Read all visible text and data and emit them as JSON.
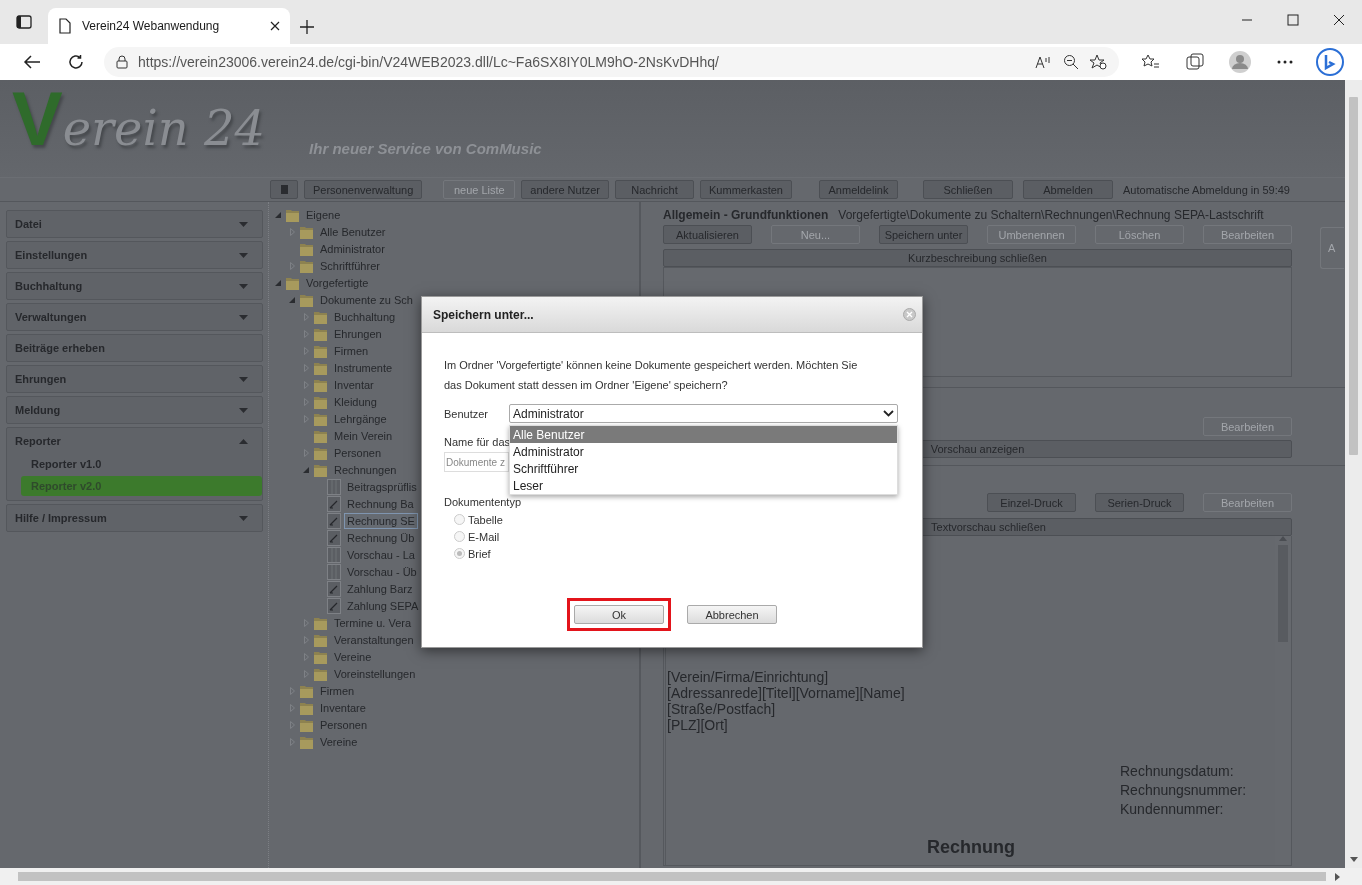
{
  "browser": {
    "tab_title": "Verein24 Webanwendung",
    "url": "https://verein23006.verein24.de/cgi-bin/V24WEB2023.dll/Lc~Fa6SX8IY0LM9hO-2NsKvDHhq/"
  },
  "header": {
    "logo": "Verein 24",
    "tagline": "Ihr neuer Service von ComMusic"
  },
  "toolbar": {
    "buttons": [
      {
        "label": "Personenverwaltung",
        "disabled": false
      },
      {
        "label": "neue Liste",
        "disabled": true
      },
      {
        "label": "andere Nutzer",
        "disabled": false
      },
      {
        "label": "Nachricht",
        "disabled": false
      },
      {
        "label": "Kummerkasten",
        "disabled": false
      },
      {
        "label": "Anmeldelink",
        "disabled": false
      },
      {
        "label": "Schließen",
        "disabled": false
      },
      {
        "label": "Abmelden",
        "disabled": false
      }
    ],
    "status": "Automatische Abmeldung in 59:49"
  },
  "sidebar": {
    "items": [
      {
        "label": "Datei",
        "kind": "menu",
        "expanded": false
      },
      {
        "label": "Einstellungen",
        "kind": "menu",
        "expanded": false
      },
      {
        "label": "Buchhaltung",
        "kind": "menu",
        "expanded": false
      },
      {
        "label": "Verwaltungen",
        "kind": "menu",
        "expanded": false
      },
      {
        "label": "Beiträge erheben",
        "kind": "link"
      },
      {
        "label": "Ehrungen",
        "kind": "menu",
        "expanded": false
      },
      {
        "label": "Meldung",
        "kind": "menu",
        "expanded": false
      },
      {
        "label": "Reporter",
        "kind": "menu",
        "expanded": true,
        "children": [
          {
            "label": "Reporter v1.0",
            "selected": false
          },
          {
            "label": "Reporter v2.0",
            "selected": true
          }
        ]
      },
      {
        "label": "Hilfe / Impressum",
        "kind": "menu",
        "expanded": false
      }
    ]
  },
  "tree": [
    {
      "label": "Eigene",
      "kind": "folder",
      "expanded": true,
      "selected": false,
      "children": [
        {
          "label": "Alle Benutzer",
          "kind": "folder",
          "expanded": false,
          "selected": false
        },
        {
          "label": "Administrator",
          "kind": "empty_folder",
          "selected": false
        },
        {
          "label": "Schriftführer",
          "kind": "folder",
          "expanded": false,
          "selected": false
        }
      ]
    },
    {
      "label": "Vorgefertigte",
      "kind": "folder",
      "expanded": true,
      "selected": false,
      "children": [
        {
          "label": "Dokumente zu Sch",
          "kind": "folder",
          "expanded": true,
          "selected": false,
          "children": [
            {
              "label": "Buchhaltung",
              "kind": "folder",
              "expanded": false,
              "selected": false
            },
            {
              "label": "Ehrungen",
              "kind": "folder",
              "expanded": false,
              "selected": false
            },
            {
              "label": "Firmen",
              "kind": "folder",
              "expanded": false,
              "selected": false
            },
            {
              "label": "Instrumente",
              "kind": "folder",
              "expanded": false,
              "selected": false
            },
            {
              "label": "Inventar",
              "kind": "folder",
              "expanded": false,
              "selected": false
            },
            {
              "label": "Kleidung",
              "kind": "folder",
              "expanded": false,
              "selected": false
            },
            {
              "label": "Lehrgänge",
              "kind": "folder",
              "expanded": false,
              "selected": false
            },
            {
              "label": "Mein Verein",
              "kind": "empty_folder",
              "selected": false
            },
            {
              "label": "Personen",
              "kind": "folder",
              "expanded": false,
              "selected": false
            },
            {
              "label": "Rechnungen",
              "kind": "folder",
              "expanded": true,
              "selected": false,
              "children": [
                {
                  "label": "Beitragsprüflis",
                  "kind": "table",
                  "selected": false
                },
                {
                  "label": "Rechnung Ba",
                  "kind": "letter",
                  "selected": false
                },
                {
                  "label": "Rechnung SE",
                  "kind": "letter",
                  "selected": true
                },
                {
                  "label": "Rechnung Üb",
                  "kind": "letter",
                  "selected": false
                },
                {
                  "label": "Vorschau - La",
                  "kind": "table",
                  "selected": false
                },
                {
                  "label": "Vorschau - Üb",
                  "kind": "table",
                  "selected": false
                },
                {
                  "label": "Zahlung Barz",
                  "kind": "letter",
                  "selected": false
                },
                {
                  "label": "Zahlung SEPA",
                  "kind": "letter",
                  "selected": false
                }
              ]
            },
            {
              "label": "Termine u. Vera",
              "kind": "folder",
              "expanded": false,
              "selected": false
            },
            {
              "label": "Veranstaltungen",
              "kind": "folder",
              "expanded": false,
              "selected": false
            },
            {
              "label": "Vereine",
              "kind": "folder",
              "expanded": false,
              "selected": false
            },
            {
              "label": "Voreinstellungen",
              "kind": "folder",
              "expanded": false,
              "selected": false
            }
          ]
        },
        {
          "label": "Firmen",
          "kind": "folder",
          "expanded": false,
          "selected": false
        },
        {
          "label": "Inventare",
          "kind": "folder",
          "expanded": false,
          "selected": false
        },
        {
          "label": "Personen",
          "kind": "folder",
          "expanded": false,
          "selected": false
        },
        {
          "label": "Vereine",
          "kind": "folder",
          "expanded": false,
          "selected": false
        }
      ]
    }
  ],
  "panel": {
    "title": "Allgemein - Grundfunktionen",
    "path": "Vorgefertigte\\Dokumente zu Schaltern\\Rechnungen\\Rechnung SEPA-Lastschrift",
    "buttons": [
      {
        "label": "Aktualisieren",
        "disabled": false
      },
      {
        "label": "Neu...",
        "disabled": true
      },
      {
        "label": "Speichern unter",
        "disabled": false
      },
      {
        "label": "Umbenennen",
        "disabled": true
      },
      {
        "label": "Löschen",
        "disabled": true
      },
      {
        "label": "Bearbeiten",
        "disabled": true
      }
    ],
    "side_button": "A",
    "description_bar": "Kurzbeschreibung schließen",
    "preview_buttons": [
      {
        "label": "Bearbeiten",
        "disabled": true
      }
    ],
    "preview_bar": "Vorschau anzeigen",
    "print_buttons": [
      {
        "label": "Einzel-Druck",
        "disabled": false
      },
      {
        "label": "Serien-Druck",
        "disabled": false
      },
      {
        "label": "Bearbeiten",
        "disabled": true
      }
    ],
    "text_preview_bar": "Textvorschau schließen",
    "document": {
      "address_lines": [
        "[Verein/Firma/Einrichtung]",
        "[Adressanrede][Titel][Vorname][Name]",
        "[Straße/Postfach]",
        "[PLZ][Ort]"
      ],
      "info_lines": [
        "Rechnungsdatum:",
        "Rechnungsnummer:",
        "Kundennummer:"
      ],
      "heading": "Rechnung"
    }
  },
  "dialog": {
    "title": "Speichern unter...",
    "message": "Im Ordner 'Vorgefertigte' können keine Dokumente gespeichert werden. Möchten Sie das Dokument statt dessen im Ordner 'Eigene' speichern?",
    "user_label": "Benutzer",
    "user_value": "Administrator",
    "user_options": [
      {
        "label": "Alle Benutzer",
        "selected": true
      },
      {
        "label": "Administrator",
        "selected": false
      },
      {
        "label": "Schriftführer",
        "selected": false
      },
      {
        "label": "Leser",
        "selected": false
      }
    ],
    "name_label": "Name für das",
    "name_placeholder": "Dokumente z",
    "type_label": "Dokumententyp",
    "types": [
      {
        "label": "Tabelle",
        "selected": false
      },
      {
        "label": "E-Mail",
        "selected": false
      },
      {
        "label": "Brief",
        "selected": true
      }
    ],
    "buttons": [
      {
        "label": "Ok",
        "highlighted": true
      },
      {
        "label": "Abbrechen",
        "highlighted": false
      }
    ]
  }
}
